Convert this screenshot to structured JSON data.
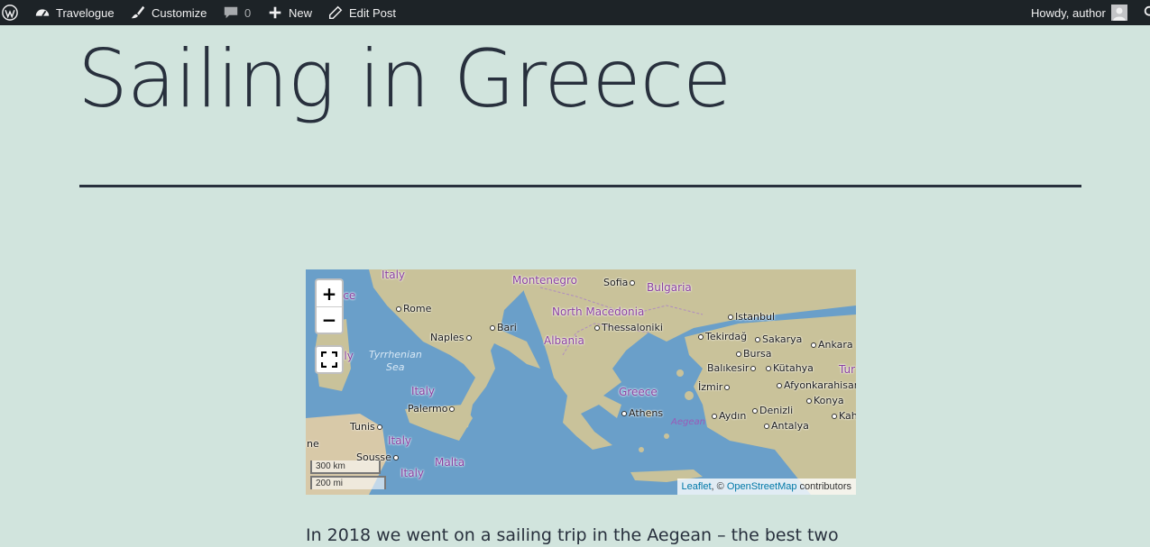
{
  "adminbar": {
    "site_name": "Travelogue",
    "customize": "Customize",
    "comments_count": "0",
    "new": "New",
    "edit_post": "Edit Post",
    "howdy": "Howdy, author",
    "icons": [
      "wordpress-logo-icon",
      "dashboard-icon",
      "brush-icon",
      "comment-icon",
      "plus-icon",
      "pencil-icon",
      "avatar",
      "search-icon"
    ]
  },
  "post": {
    "title": "Sailing in Greece",
    "intro": "In 2018 we went on a sailing trip in the Aegean – the best two"
  },
  "map": {
    "zoom_in": "+",
    "zoom_out": "−",
    "scale_km": "300 km",
    "scale_mi": "200 mi",
    "attribution": {
      "leaflet": "Leaflet",
      "sep": ", © ",
      "osm": "OpenStreetMap",
      "suffix": " contributors"
    },
    "labels": {
      "italy_top": "Italy",
      "montenegro": "Montenegro",
      "sofia": "Sofia",
      "bulgaria": "Bulgaria",
      "ice": "ice",
      "rome": "Rome",
      "north_macedonia": "North Macedonia",
      "istanbul": "Istanbul",
      "bari": "Bari",
      "albania": "Albania",
      "thessaloniki": "Thessaloniki",
      "tekirdag": "Tekirdağ",
      "sakarya": "Sakarya",
      "ankara": "Ankara",
      "naples": "Naples",
      "bursa": "Bursa",
      "aly": "aly",
      "tyrrhenian": "Tyrrhenian",
      "sea": "Sea",
      "balikesir": "Balıkesir",
      "kutahya": "Kütahya",
      "tur": "Tur",
      "italy_mid": "Italy",
      "greece": "Greece",
      "izmir": "İzmir",
      "afyon": "Afyonkarahisar",
      "palermo": "Palermo",
      "konya": "Konya",
      "athens": "Athens",
      "aydin": "Aydın",
      "denizli": "Denizli",
      "kahra": "Kahra",
      "aegean": "Aegean",
      "tunis": "Tunis",
      "antalya": "Antalya",
      "italy_low": "Italy",
      "ne": "ne",
      "sousse": "Sousse",
      "malta": "Malta",
      "italy_bottom": "Italy"
    }
  },
  "colors": {
    "background": "#d1e4dd",
    "text": "#28303d",
    "adminbar": "#1d2327",
    "sea": "#6a9fc9",
    "land": "#c9c29a",
    "link": "#0078a8"
  }
}
